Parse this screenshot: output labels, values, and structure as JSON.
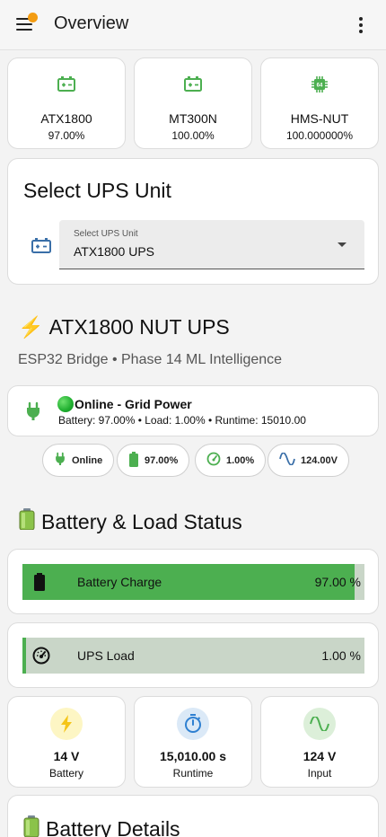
{
  "appbar": {
    "title": "Overview"
  },
  "ups_cards": [
    {
      "name": "ATX1800",
      "percent": "97.00%",
      "icon": "battery-icon"
    },
    {
      "name": "MT300N",
      "percent": "100.00%",
      "icon": "battery-icon"
    },
    {
      "name": "HMS-NUT",
      "percent": "100.000000%",
      "icon": "chip-icon"
    }
  ],
  "select": {
    "title": "Select UPS Unit",
    "field_label": "Select UPS Unit",
    "value": "ATX1800 UPS"
  },
  "ups_header": {
    "emoji": "⚡",
    "title": "ATX1800 NUT UPS",
    "subtitle": "ESP32 Bridge • Phase 14 ML Intelligence"
  },
  "status": {
    "headline": "Online - Grid Power",
    "detail": "Battery: 97.00% • Load: 1.00% • Runtime: 15010.00"
  },
  "chips": [
    {
      "label": "Online",
      "icon": "plug-icon"
    },
    {
      "label": "97.00%",
      "icon": "battery-icon"
    },
    {
      "label": "1.00%",
      "icon": "gauge-icon"
    },
    {
      "label": "124.00V",
      "icon": "sine-wave-icon"
    }
  ],
  "battery_load_section": {
    "emoji": "🔋",
    "title": "Battery & Load Status"
  },
  "bars": {
    "battery": {
      "label": "Battery Charge",
      "value_text": "97.00 %",
      "fraction": 0.97
    },
    "load": {
      "label": "UPS Load",
      "value_text": "1.00 %",
      "fraction": 0.01
    }
  },
  "metrics": [
    {
      "value": "14 V",
      "label": "Battery",
      "icon": "bolt-icon"
    },
    {
      "value": "15,010.00 s",
      "label": "Runtime",
      "icon": "timer-icon"
    },
    {
      "value": "124 V",
      "label": "Input",
      "icon": "sine-wave-icon"
    }
  ],
  "details_section": {
    "emoji": "🔋",
    "title": "Battery Details"
  },
  "colors": {
    "accent_green": "#4caf50",
    "notification": "#f39c12",
    "icon_blue": "#3a6fa8"
  }
}
